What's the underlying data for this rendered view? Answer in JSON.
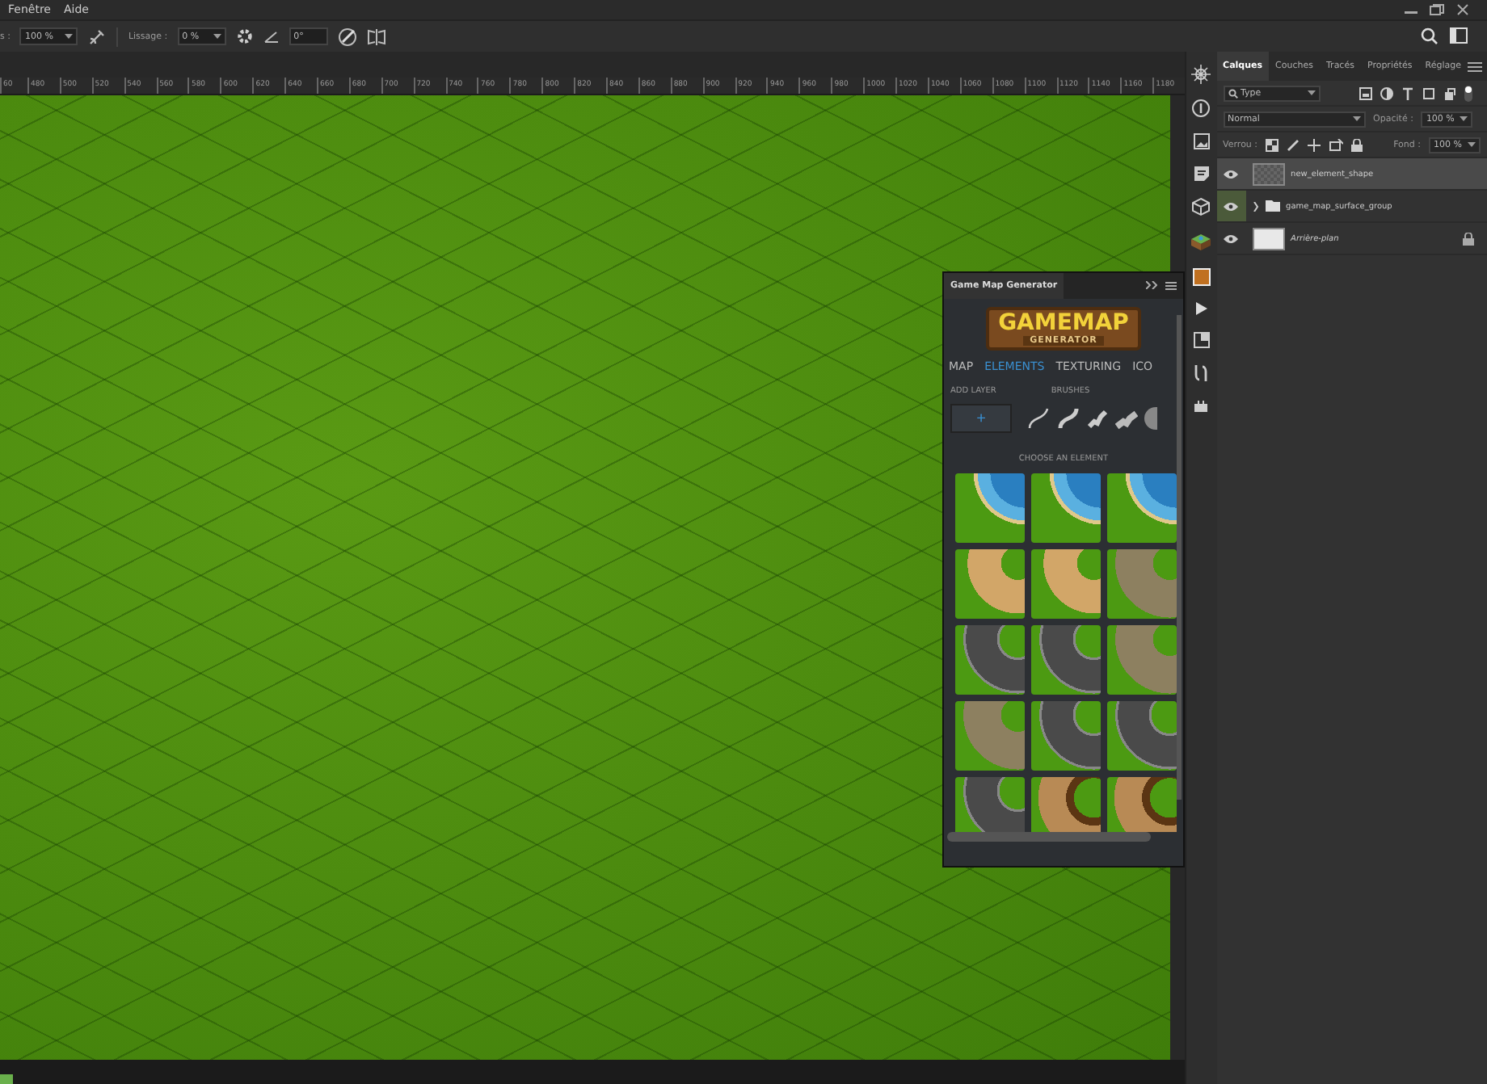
{
  "menu": [
    "Fenêtre",
    "Aide"
  ],
  "options_bar": {
    "flow_label": "s :",
    "flow_value": "100 %",
    "smoothing_label": "Lissage :",
    "smoothing_value": "0 %",
    "angle_value": "0°"
  },
  "ruler": [
    "60",
    "480",
    "500",
    "520",
    "540",
    "560",
    "580",
    "600",
    "620",
    "640",
    "660",
    "680",
    "700",
    "720",
    "740",
    "760",
    "780",
    "800",
    "820",
    "840",
    "860",
    "880",
    "900",
    "920",
    "940",
    "960",
    "980",
    "1000",
    "1020",
    "1040",
    "1060",
    "1080",
    "1100",
    "1120",
    "1140",
    "1160",
    "1180"
  ],
  "layers_panel": {
    "tabs": [
      {
        "label": "Calques",
        "selected": true
      },
      {
        "label": "Couches",
        "selected": false
      },
      {
        "label": "Tracés",
        "selected": false
      },
      {
        "label": "Propriétés",
        "selected": false
      },
      {
        "label": "Réglage",
        "selected": false
      }
    ],
    "filter": "Type",
    "blend_mode": "Normal",
    "opacity_label": "Opacité :",
    "opacity": "100 %",
    "lock_label": "Verrou :",
    "fill_label": "Fond :",
    "fill": "100 %",
    "layers": [
      {
        "name": "new_element_shape",
        "kind": "shape",
        "selected": true,
        "locked": false
      },
      {
        "name": "game_map_surface_group",
        "kind": "group",
        "selected": false,
        "locked": false
      },
      {
        "name": "Arrière-plan",
        "kind": "background",
        "selected": false,
        "locked": true
      }
    ]
  },
  "plugin": {
    "title": "Game Map Generator",
    "logo_top": "GAMEMAP",
    "logo_bottom": "GENERATOR",
    "tabs": [
      {
        "label": "MAP",
        "selected": false
      },
      {
        "label": "ELEMENTS",
        "selected": true
      },
      {
        "label": "TEXTURING",
        "selected": false
      },
      {
        "label": "ICO",
        "selected": false
      }
    ],
    "add_layer_label": "ADD LAYER",
    "add_button": "+",
    "brushes_label": "BRUSHES",
    "choose_label": "CHOOSE AN ELEMENT",
    "tiles": [
      {
        "kind": "water"
      },
      {
        "kind": "water"
      },
      {
        "kind": "water"
      },
      {
        "kind": "sand"
      },
      {
        "kind": "sand"
      },
      {
        "kind": "cobble"
      },
      {
        "kind": "asphalt"
      },
      {
        "kind": "asphalt"
      },
      {
        "kind": "cobble"
      },
      {
        "kind": "cobble"
      },
      {
        "kind": "asphalt"
      },
      {
        "kind": "asphalt"
      },
      {
        "kind": "asphalt"
      },
      {
        "kind": "dirt"
      },
      {
        "kind": "dirt"
      }
    ]
  }
}
